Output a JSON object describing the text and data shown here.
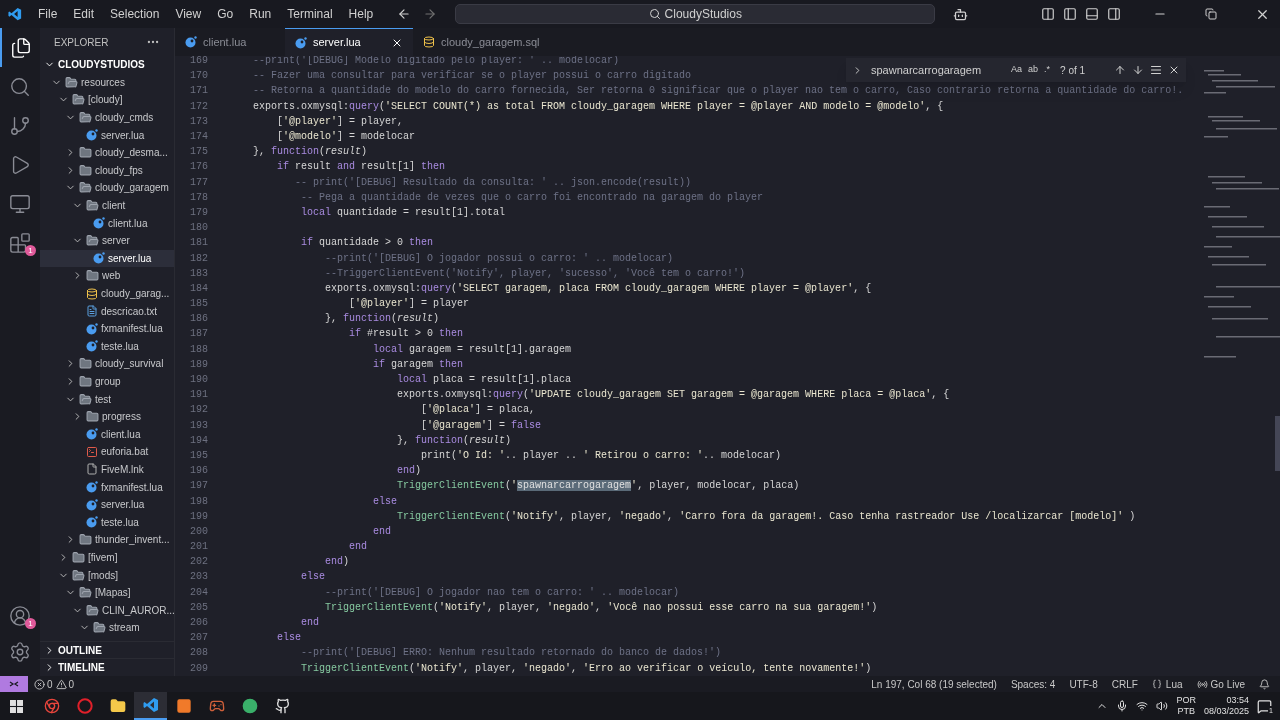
{
  "menu": [
    "File",
    "Edit",
    "Selection",
    "View",
    "Go",
    "Run",
    "Terminal",
    "Help"
  ],
  "command_center": "CloudyStudios",
  "activity_bar": [
    {
      "kind": "explorer",
      "selected": true
    },
    {
      "kind": "search",
      "selected": false
    },
    {
      "kind": "source-control",
      "selected": false
    },
    {
      "kind": "run",
      "selected": false
    },
    {
      "kind": "remote",
      "selected": false
    },
    {
      "kind": "extensions",
      "selected": false,
      "badge": "1"
    }
  ],
  "activity_bottom": [
    {
      "kind": "account",
      "badge": "1"
    },
    {
      "kind": "settings"
    }
  ],
  "explorer": {
    "title": "EXPLORER",
    "root": "CLOUDYSTUDIOS",
    "root_expanded": true,
    "tree": [
      {
        "label": "resources",
        "kind": "folder",
        "expanded": true,
        "selected": false,
        "children": [
          {
            "label": "[cloudy]",
            "kind": "folder",
            "expanded": true,
            "selected": false,
            "children": [
              {
                "label": "cloudy_cmds",
                "kind": "folder",
                "expanded": true,
                "selected": false,
                "children": [
                  {
                    "label": "server.lua",
                    "kind": "lua",
                    "selected": false
                  }
                ]
              },
              {
                "label": "cloudy_desma...",
                "kind": "folder",
                "expanded": false,
                "selected": false
              },
              {
                "label": "cloudy_fps",
                "kind": "folder",
                "expanded": false,
                "selected": false
              },
              {
                "label": "cloudy_garagem",
                "kind": "folder",
                "expanded": true,
                "selected": false,
                "children": [
                  {
                    "label": "client",
                    "kind": "folder",
                    "expanded": true,
                    "selected": false,
                    "children": [
                      {
                        "label": "client.lua",
                        "kind": "lua",
                        "selected": false
                      }
                    ]
                  },
                  {
                    "label": "server",
                    "kind": "folder",
                    "expanded": true,
                    "selected": false,
                    "children": [
                      {
                        "label": "server.lua",
                        "kind": "lua",
                        "selected": true
                      }
                    ]
                  },
                  {
                    "label": "web",
                    "kind": "folder",
                    "expanded": false,
                    "selected": false
                  },
                  {
                    "label": "cloudy_garag...",
                    "kind": "sql",
                    "selected": false
                  },
                  {
                    "label": "descricao.txt",
                    "kind": "txt",
                    "selected": false
                  },
                  {
                    "label": "fxmanifest.lua",
                    "kind": "lua",
                    "selected": false
                  },
                  {
                    "label": "teste.lua",
                    "kind": "lua",
                    "selected": false
                  }
                ]
              },
              {
                "label": "cloudy_survival",
                "kind": "folder",
                "expanded": false,
                "selected": false
              },
              {
                "label": "group",
                "kind": "folder",
                "expanded": false,
                "selected": false
              },
              {
                "label": "test",
                "kind": "folder",
                "expanded": true,
                "selected": false,
                "children": [
                  {
                    "label": "progress",
                    "kind": "folder",
                    "expanded": false,
                    "selected": false
                  },
                  {
                    "label": "client.lua",
                    "kind": "lua",
                    "selected": false
                  },
                  {
                    "label": "euforia.bat",
                    "kind": "bat",
                    "selected": false
                  },
                  {
                    "label": "FiveM.lnk",
                    "kind": "lnk",
                    "selected": false
                  },
                  {
                    "label": "fxmanifest.lua",
                    "kind": "lua",
                    "selected": false
                  },
                  {
                    "label": "server.lua",
                    "kind": "lua",
                    "selected": false
                  },
                  {
                    "label": "teste.lua",
                    "kind": "lua",
                    "selected": false
                  }
                ]
              },
              {
                "label": "thunder_invent...",
                "kind": "folder",
                "expanded": false,
                "selected": false
              }
            ]
          },
          {
            "label": "[fivem]",
            "kind": "folder",
            "expanded": false,
            "selected": false
          },
          {
            "label": "[mods]",
            "kind": "folder",
            "expanded": true,
            "selected": false,
            "children": [
              {
                "label": "[Mapas]",
                "kind": "folder",
                "expanded": true,
                "selected": false,
                "children": [
                  {
                    "label": "CLIN_AUROR...",
                    "kind": "folder",
                    "expanded": true,
                    "selected": false,
                    "children": [
                      {
                        "label": "stream",
                        "kind": "folder",
                        "expanded": true,
                        "selected": false
                      }
                    ]
                  }
                ]
              }
            ]
          }
        ]
      }
    ],
    "sections": [
      {
        "label": "OUTLINE",
        "expanded": false
      },
      {
        "label": "TIMELINE",
        "expanded": false
      }
    ]
  },
  "tabs": [
    {
      "label": "client.lua",
      "kind": "lua",
      "selected": false
    },
    {
      "label": "server.lua",
      "kind": "lua",
      "selected": true
    },
    {
      "label": "cloudy_garagem.sql",
      "kind": "sql",
      "selected": false
    }
  ],
  "find": {
    "value": "spawnarcarrogaragem",
    "toggles": [
      "Aa",
      "ab",
      ".*"
    ],
    "count": "? of 1"
  },
  "code": [
    {
      "number": "169",
      "segments": [
        {
          "kind": "comment",
          "text": "    --print('[DEBUG] Modelo digitado pelo player: ' .. modelocar)"
        }
      ]
    },
    {
      "number": "170",
      "segments": [
        {
          "kind": "comment",
          "text": "    -- Fazer uma consultar para verificar se o player possui o carro digitado"
        }
      ]
    },
    {
      "number": "171",
      "segments": [
        {
          "kind": "comment",
          "text": "    -- Retorna a quantidade do modelo do carro fornecida, Ser retorna 0 significar que o player nao tem o carro, Caso contrario retorna a quantidade do carro!."
        }
      ]
    },
    {
      "number": "172",
      "segments": [
        {
          "kind": "plain",
          "text": "    exports.oxmysql:"
        },
        {
          "kind": "method",
          "text": "query"
        },
        {
          "kind": "plain",
          "text": "("
        },
        {
          "kind": "string",
          "text": "'SELECT COUNT(*) as total FROM cloudy_garagem WHERE player = @player AND modelo = @modelo'"
        },
        {
          "kind": "plain",
          "text": ", {"
        }
      ]
    },
    {
      "number": "173",
      "segments": [
        {
          "kind": "plain",
          "text": "        ["
        },
        {
          "kind": "string",
          "text": "'@player'"
        },
        {
          "kind": "plain",
          "text": "] = player,"
        }
      ]
    },
    {
      "number": "174",
      "segments": [
        {
          "kind": "plain",
          "text": "        ["
        },
        {
          "kind": "string",
          "text": "'@modelo'"
        },
        {
          "kind": "plain",
          "text": "] = modelocar"
        }
      ]
    },
    {
      "number": "175",
      "segments": [
        {
          "kind": "plain",
          "text": "    }, "
        },
        {
          "kind": "keyword",
          "text": "function"
        },
        {
          "kind": "plain",
          "text": "("
        },
        {
          "kind": "param",
          "text": "result"
        },
        {
          "kind": "plain",
          "text": ")"
        }
      ]
    },
    {
      "number": "176",
      "segments": [
        {
          "kind": "keyword",
          "text": "        if"
        },
        {
          "kind": "plain",
          "text": " result "
        },
        {
          "kind": "keyword",
          "text": "and"
        },
        {
          "kind": "plain",
          "text": " result[1] "
        },
        {
          "kind": "keyword",
          "text": "then"
        }
      ]
    },
    {
      "number": "177",
      "segments": [
        {
          "kind": "comment",
          "text": "           -- print('[DEBUG] Resultado da consulta: ' .. json.encode(result))"
        }
      ]
    },
    {
      "number": "178",
      "segments": [
        {
          "kind": "comment",
          "text": "            -- Pega a quantidade de vezes que o carro foi encontrado na garagem do player"
        }
      ]
    },
    {
      "number": "179",
      "segments": [
        {
          "kind": "keyword",
          "text": "            local"
        },
        {
          "kind": "plain",
          "text": " quantidade = result[1].total"
        }
      ]
    },
    {
      "number": "180"
    },
    {
      "number": "181",
      "segments": [
        {
          "kind": "keyword",
          "text": "            if"
        },
        {
          "kind": "plain",
          "text": " quantidade > 0 "
        },
        {
          "kind": "keyword",
          "text": "then"
        }
      ]
    },
    {
      "number": "182",
      "segments": [
        {
          "kind": "comment",
          "text": "                --print('[DEBUG] O jogador possui o carro: ' .. modelocar)"
        }
      ]
    },
    {
      "number": "183",
      "segments": [
        {
          "kind": "comment",
          "text": "                --TriggerClientEvent('Notify', player, 'sucesso', 'Você tem o carro!')"
        }
      ]
    },
    {
      "number": "184",
      "segments": [
        {
          "kind": "plain",
          "text": "                exports.oxmysql:"
        },
        {
          "kind": "method",
          "text": "query"
        },
        {
          "kind": "plain",
          "text": "("
        },
        {
          "kind": "string",
          "text": "'SELECT garagem, placa FROM cloudy_garagem WHERE player = @player'"
        },
        {
          "kind": "plain",
          "text": ", {"
        }
      ]
    },
    {
      "number": "185",
      "segments": [
        {
          "kind": "plain",
          "text": "                    ["
        },
        {
          "kind": "string",
          "text": "'@player'"
        },
        {
          "kind": "plain",
          "text": "] = player"
        }
      ]
    },
    {
      "number": "186",
      "segments": [
        {
          "kind": "plain",
          "text": "                }, "
        },
        {
          "kind": "keyword",
          "text": "function"
        },
        {
          "kind": "plain",
          "text": "("
        },
        {
          "kind": "param",
          "text": "result"
        },
        {
          "kind": "plain",
          "text": ")"
        }
      ]
    },
    {
      "number": "187",
      "segments": [
        {
          "kind": "keyword",
          "text": "                    if"
        },
        {
          "kind": "plain",
          "text": " #result > 0 "
        },
        {
          "kind": "keyword",
          "text": "then"
        }
      ]
    },
    {
      "number": "188",
      "segments": [
        {
          "kind": "keyword",
          "text": "                        local"
        },
        {
          "kind": "plain",
          "text": " garagem = result[1].garagem"
        }
      ]
    },
    {
      "number": "189",
      "segments": [
        {
          "kind": "keyword",
          "text": "                        if"
        },
        {
          "kind": "plain",
          "text": " garagem "
        },
        {
          "kind": "keyword",
          "text": "then"
        }
      ]
    },
    {
      "number": "190",
      "segments": [
        {
          "kind": "keyword",
          "text": "                            local"
        },
        {
          "kind": "plain",
          "text": " placa = result[1].placa"
        }
      ]
    },
    {
      "number": "191",
      "segments": [
        {
          "kind": "plain",
          "text": "                            exports.oxmysql:"
        },
        {
          "kind": "method",
          "text": "query"
        },
        {
          "kind": "plain",
          "text": "("
        },
        {
          "kind": "string",
          "text": "'UPDATE cloudy_garagem SET garagem = @garagem WHERE placa = @placa'"
        },
        {
          "kind": "plain",
          "text": ", {"
        }
      ]
    },
    {
      "number": "192",
      "segments": [
        {
          "kind": "plain",
          "text": "                                ["
        },
        {
          "kind": "string",
          "text": "'@placa'"
        },
        {
          "kind": "plain",
          "text": "] = placa,"
        }
      ]
    },
    {
      "number": "193",
      "segments": [
        {
          "kind": "plain",
          "text": "                                ["
        },
        {
          "kind": "string",
          "text": "'@garagem'"
        },
        {
          "kind": "plain",
          "text": "] = "
        },
        {
          "kind": "keyword",
          "text": "false"
        }
      ]
    },
    {
      "number": "194",
      "segments": [
        {
          "kind": "plain",
          "text": "                            }, "
        },
        {
          "kind": "keyword",
          "text": "function"
        },
        {
          "kind": "plain",
          "text": "("
        },
        {
          "kind": "param",
          "text": "result"
        },
        {
          "kind": "plain",
          "text": ")"
        }
      ]
    },
    {
      "number": "195",
      "segments": [
        {
          "kind": "plain",
          "text": "                                print("
        },
        {
          "kind": "string",
          "text": "'O Id: '"
        },
        {
          "kind": "plain",
          "text": ".. player .. "
        },
        {
          "kind": "string",
          "text": "' Retirou o carro: '"
        },
        {
          "kind": "plain",
          "text": ".. modelocar)"
        }
      ]
    },
    {
      "number": "196",
      "segments": [
        {
          "kind": "keyword",
          "text": "                            end"
        },
        {
          "kind": "plain",
          "text": ")"
        }
      ]
    },
    {
      "number": "197",
      "segments": [
        {
          "kind": "call",
          "text": "                            TriggerClientEvent"
        },
        {
          "kind": "plain",
          "text": "("
        },
        {
          "kind": "string",
          "text": "'"
        },
        {
          "kind": "match",
          "text": "spawnarcarrogaragem"
        },
        {
          "kind": "string",
          "text": "'"
        },
        {
          "kind": "plain",
          "text": ", player, modelocar, placa)"
        }
      ]
    },
    {
      "number": "198",
      "segments": [
        {
          "kind": "keyword",
          "text": "                        else"
        }
      ]
    },
    {
      "number": "199",
      "segments": [
        {
          "kind": "call",
          "text": "                            TriggerClientEvent"
        },
        {
          "kind": "plain",
          "text": "("
        },
        {
          "kind": "string",
          "text": "'Notify'"
        },
        {
          "kind": "plain",
          "text": ", player, "
        },
        {
          "kind": "string",
          "text": "'negado'"
        },
        {
          "kind": "plain",
          "text": ", "
        },
        {
          "kind": "string",
          "text": "'Carro fora da garagem!. Caso tenha rastreador Use /localizarcar [modelo]'"
        },
        {
          "kind": "plain",
          "text": " )"
        }
      ]
    },
    {
      "number": "200",
      "segments": [
        {
          "kind": "keyword",
          "text": "                        end"
        }
      ]
    },
    {
      "number": "201",
      "segments": [
        {
          "kind": "keyword",
          "text": "                    end"
        }
      ]
    },
    {
      "number": "202",
      "segments": [
        {
          "kind": "keyword",
          "text": "                end"
        },
        {
          "kind": "plain",
          "text": ")"
        }
      ]
    },
    {
      "number": "203",
      "segments": [
        {
          "kind": "keyword",
          "text": "            else"
        }
      ]
    },
    {
      "number": "204",
      "segments": [
        {
          "kind": "comment",
          "text": "                --print('[DEBUG] O jogador nao tem o carro: ' .. modelocar)"
        }
      ]
    },
    {
      "number": "205",
      "segments": [
        {
          "kind": "call",
          "text": "                TriggerClientEvent"
        },
        {
          "kind": "plain",
          "text": "("
        },
        {
          "kind": "string",
          "text": "'Notify'"
        },
        {
          "kind": "plain",
          "text": ", player, "
        },
        {
          "kind": "string",
          "text": "'negado'"
        },
        {
          "kind": "plain",
          "text": ", "
        },
        {
          "kind": "string",
          "text": "'Você nao possui esse carro na sua garagem!'"
        },
        {
          "kind": "plain",
          "text": ")"
        }
      ]
    },
    {
      "number": "206",
      "segments": [
        {
          "kind": "keyword",
          "text": "            end"
        }
      ]
    },
    {
      "number": "207",
      "segments": [
        {
          "kind": "keyword",
          "text": "        else"
        }
      ]
    },
    {
      "number": "208",
      "segments": [
        {
          "kind": "comment",
          "text": "            --print('[DEBUG] ERRO: Nenhum resultado retornado do banco de dados!')"
        }
      ]
    },
    {
      "number": "209",
      "segments": [
        {
          "kind": "call",
          "text": "            TriggerClientEvent"
        },
        {
          "kind": "plain",
          "text": "("
        },
        {
          "kind": "string",
          "text": "'Notify'"
        },
        {
          "kind": "plain",
          "text": ", player, "
        },
        {
          "kind": "string",
          "text": "'negado'"
        },
        {
          "kind": "plain",
          "text": ", "
        },
        {
          "kind": "string",
          "text": "'Erro ao verificar o veículo, tente novamente!'"
        },
        {
          "kind": "plain",
          "text": ")"
        }
      ]
    }
  ],
  "status_bar": {
    "errors": "0",
    "warnings": "0",
    "right": [
      {
        "kind": "text",
        "text": "Ln 197, Col 68 (19 selected)"
      },
      {
        "kind": "text",
        "text": "Spaces: 4"
      },
      {
        "kind": "text",
        "text": "UTF-8"
      },
      {
        "kind": "text",
        "text": "CRLF"
      },
      {
        "kind": "language",
        "text": "Lua"
      },
      {
        "kind": "live",
        "text": "Go Live"
      },
      {
        "kind": "bell"
      }
    ]
  },
  "taskbar": {
    "apps": [
      {
        "kind": "chrome",
        "selected": false
      },
      {
        "kind": "opera",
        "selected": false
      },
      {
        "kind": "folder",
        "selected": false
      },
      {
        "kind": "vscode",
        "selected": true
      },
      {
        "kind": "orange",
        "selected": false
      },
      {
        "kind": "game",
        "selected": false
      },
      {
        "kind": "green",
        "selected": false
      },
      {
        "kind": "github",
        "selected": false
      }
    ],
    "language": "POR",
    "layout": "PTB",
    "time": "03:54",
    "date": "08/03/2025",
    "notifications": "1"
  }
}
